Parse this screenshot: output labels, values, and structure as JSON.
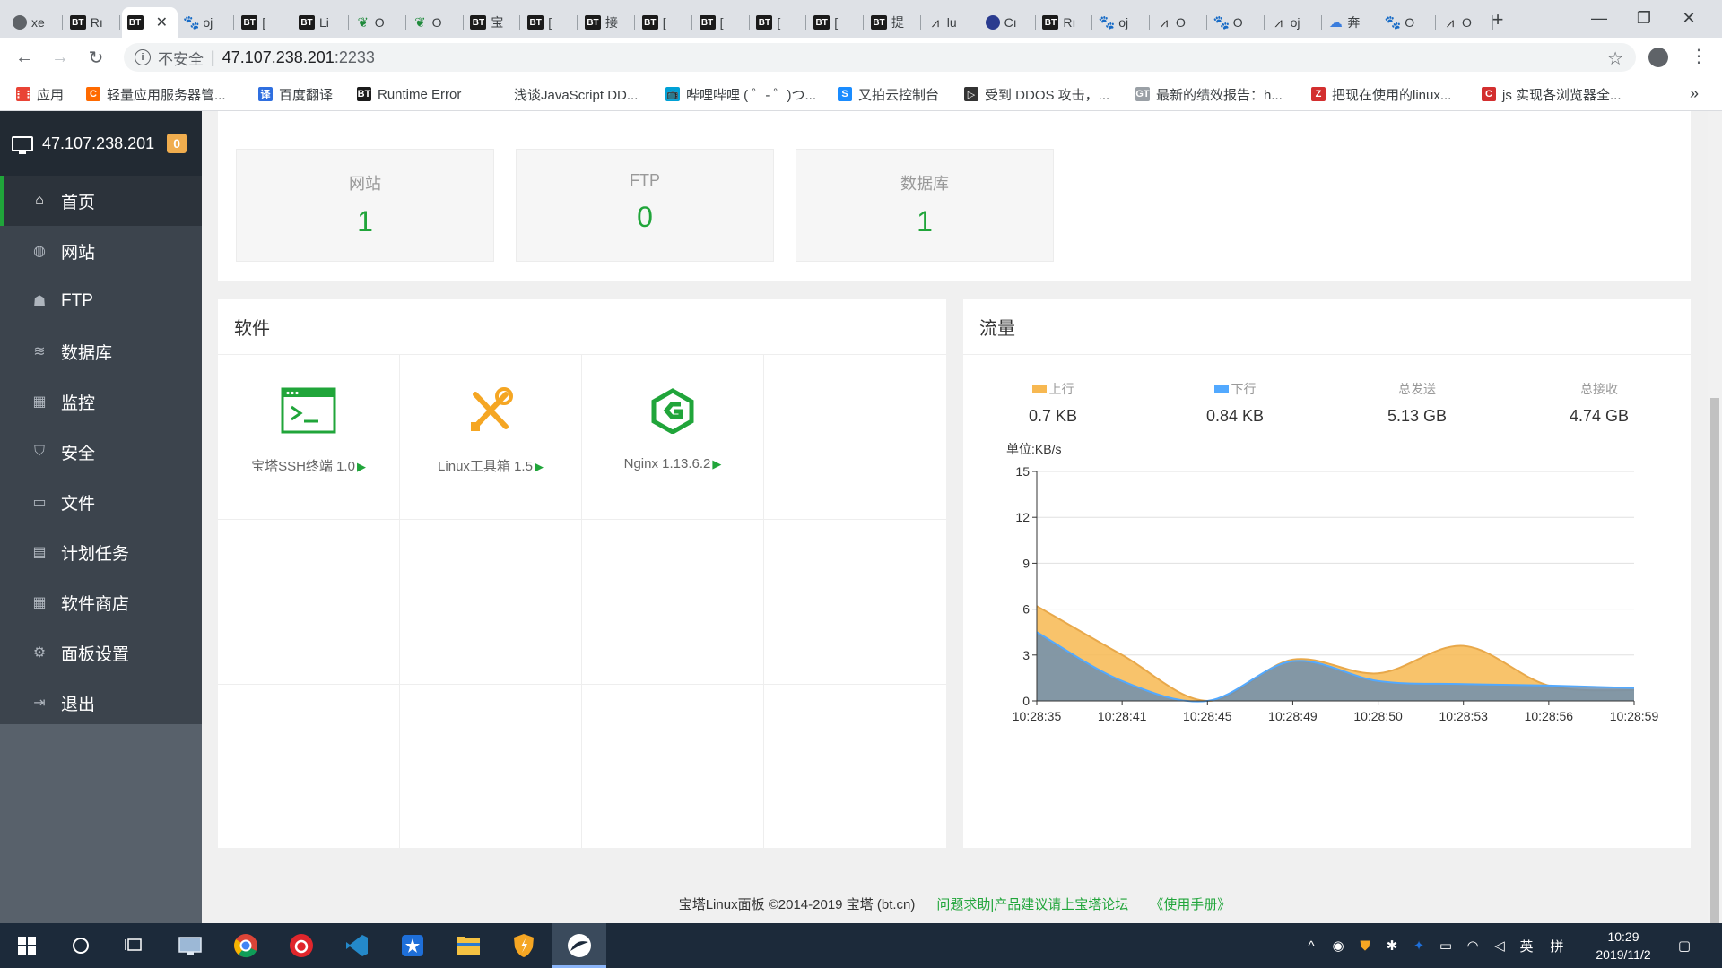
{
  "browser": {
    "tabs": [
      {
        "icon": "circle",
        "label": "xe"
      },
      {
        "icon": "bt",
        "label": "Rı"
      },
      {
        "icon": "bt",
        "label": "",
        "active": true
      },
      {
        "icon": "paw",
        "label": "oj"
      },
      {
        "icon": "bt",
        "label": "["
      },
      {
        "icon": "bt",
        "label": "Li"
      },
      {
        "icon": "bird",
        "label": "O"
      },
      {
        "icon": "bird",
        "label": "O"
      },
      {
        "icon": "bt",
        "label": "宝"
      },
      {
        "icon": "bt",
        "label": "["
      },
      {
        "icon": "bt",
        "label": "接"
      },
      {
        "icon": "bt",
        "label": "["
      },
      {
        "icon": "bt",
        "label": "["
      },
      {
        "icon": "bt",
        "label": "["
      },
      {
        "icon": "bt",
        "label": "["
      },
      {
        "icon": "bt",
        "label": "提"
      },
      {
        "icon": "line",
        "label": "lu"
      },
      {
        "icon": "dot",
        "label": "Cı"
      },
      {
        "icon": "bt",
        "label": "Rı"
      },
      {
        "icon": "paw",
        "label": "oj"
      },
      {
        "icon": "line",
        "label": "O"
      },
      {
        "icon": "paw",
        "label": "O"
      },
      {
        "icon": "line",
        "label": "oj"
      },
      {
        "icon": "cloud",
        "label": "奔"
      },
      {
        "icon": "paw",
        "label": "O"
      },
      {
        "icon": "line",
        "label": "O"
      }
    ],
    "url": {
      "insecure_label": "不安全",
      "separator": "|",
      "host": "47.107.238.201",
      "port": ":2233"
    },
    "bookmarks": [
      {
        "icon_color": "#e94335",
        "icon_text": "⋮⋮",
        "label": "应用"
      },
      {
        "icon_color": "#ff6a00",
        "icon_text": "C",
        "label": "轻量应用服务器管..."
      },
      {
        "icon_color": "#2f6fe0",
        "icon_text": "译",
        "label": "百度翻译"
      },
      {
        "icon_color": "#1b1b1b",
        "icon_text": "BT",
        "label": "Runtime Error"
      },
      {
        "icon_color": "#ffffff",
        "icon_text": "",
        "label": "浅谈JavaScript DD..."
      },
      {
        "icon_color": "#00a1d6",
        "icon_text": "📺",
        "label": "哔哩哔哩 ( ゜- ゜)つ..."
      },
      {
        "icon_color": "#1a8cff",
        "icon_text": "S",
        "label": "又拍云控制台"
      },
      {
        "icon_color": "#333333",
        "icon_text": "▷",
        "label": "受到 DDOS 攻击，..."
      },
      {
        "icon_color": "#9aa0a6",
        "icon_text": "GT",
        "label": "最新的绩效报告：h..."
      },
      {
        "icon_color": "#d32f2f",
        "icon_text": "Z",
        "label": "把现在使用的linux..."
      },
      {
        "icon_color": "#d32f2f",
        "icon_text": "C",
        "label": "js 实现各浏览器全..."
      }
    ]
  },
  "sidebar": {
    "server_ip": "47.107.238.201",
    "badge": "0",
    "items": [
      {
        "label": "首页",
        "icon": "home-icon",
        "glyph": "⌂",
        "active": true
      },
      {
        "label": "网站",
        "icon": "globe-icon",
        "glyph": "◍"
      },
      {
        "label": "FTP",
        "icon": "ftp-icon",
        "glyph": "☗"
      },
      {
        "label": "数据库",
        "icon": "database-icon",
        "glyph": "≋"
      },
      {
        "label": "监控",
        "icon": "monitor-chart-icon",
        "glyph": "▦"
      },
      {
        "label": "安全",
        "icon": "shield-icon",
        "glyph": "⛉"
      },
      {
        "label": "文件",
        "icon": "folder-icon",
        "glyph": "▭"
      },
      {
        "label": "计划任务",
        "icon": "calendar-icon",
        "glyph": "▤"
      },
      {
        "label": "软件商店",
        "icon": "grid-icon",
        "glyph": "▦"
      },
      {
        "label": "面板设置",
        "icon": "gear-icon",
        "glyph": "⚙"
      },
      {
        "label": "退出",
        "icon": "logout-icon",
        "glyph": "⇥"
      }
    ],
    "add_label": "+"
  },
  "stats": [
    {
      "label": "网站",
      "value": "1"
    },
    {
      "label": "FTP",
      "value": "0"
    },
    {
      "label": "数据库",
      "value": "1"
    }
  ],
  "software": {
    "title": "软件",
    "items": [
      {
        "name": "宝塔SSH终端 1.0",
        "icon": "terminal-icon"
      },
      {
        "name": "Linux工具箱 1.5",
        "icon": "tools-icon"
      },
      {
        "name": "Nginx 1.13.6.2",
        "icon": "nginx-icon"
      }
    ],
    "play_glyph": "▶"
  },
  "flow": {
    "title": "流量",
    "stats": [
      {
        "label": "上行",
        "value": "0.7 KB",
        "color": "#f7b851"
      },
      {
        "label": "下行",
        "value": "0.84 KB",
        "color": "#52a9ff"
      },
      {
        "label": "总发送",
        "value": "5.13 GB"
      },
      {
        "label": "总接收",
        "value": "4.74 GB"
      }
    ]
  },
  "chart_data": {
    "type": "area",
    "title": "",
    "ylabel": "单位:KB/s",
    "xlabel": "",
    "ylim": [
      0,
      15
    ],
    "yticks": [
      0,
      3,
      6,
      9,
      12,
      15
    ],
    "x": [
      "10:28:35",
      "10:28:41",
      "10:28:45",
      "10:28:49",
      "10:28:50",
      "10:28:53",
      "10:28:56",
      "10:28:59"
    ],
    "series": [
      {
        "name": "上行",
        "color": "#f7b851",
        "values": [
          6.2,
          3.0,
          0.0,
          2.7,
          1.8,
          3.6,
          1.0,
          0.7
        ]
      },
      {
        "name": "下行",
        "color": "#52a9ff",
        "values": [
          4.5,
          1.3,
          0.0,
          2.6,
          1.3,
          1.1,
          1.0,
          0.84
        ]
      }
    ],
    "grid": true
  },
  "footer": {
    "copyright": "宝塔Linux面板 ©2014-2019 宝塔 (bt.cn)",
    "forum_link": "问题求助|产品建议请上宝塔论坛",
    "manual_link": "《使用手册》"
  },
  "taskbar": {
    "time": "10:29",
    "date": "2019/11/2",
    "ime_label": "英",
    "ime_mode": "拼"
  }
}
